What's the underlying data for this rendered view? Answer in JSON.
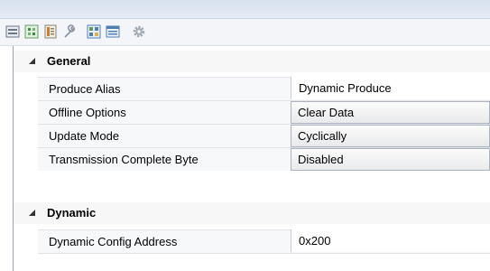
{
  "toolbar": {
    "icons": [
      "categorized-view-icon",
      "alphabetical-view-icon",
      "property-pages-icon",
      "wrench-icon",
      "grid-view-icon",
      "list-view-icon",
      "gear-icon"
    ]
  },
  "categories": [
    {
      "label": "General",
      "rows": [
        {
          "name": "Produce Alias",
          "value": "Dynamic Produce",
          "type": "text"
        },
        {
          "name": "Offline Options",
          "value": "Clear Data",
          "type": "dropdown"
        },
        {
          "name": "Update Mode",
          "value": "Cyclically",
          "type": "dropdown"
        },
        {
          "name": "Transmission Complete Byte",
          "value": "Disabled",
          "type": "dropdown"
        }
      ]
    },
    {
      "label": "Dynamic",
      "rows": [
        {
          "name": "Dynamic Config Address",
          "value": "0x200",
          "type": "text"
        }
      ]
    }
  ],
  "colors": {
    "accent_blue": "#3a6ea5",
    "row_bg": "#f7f8fa",
    "border": "#dfe3e8"
  }
}
